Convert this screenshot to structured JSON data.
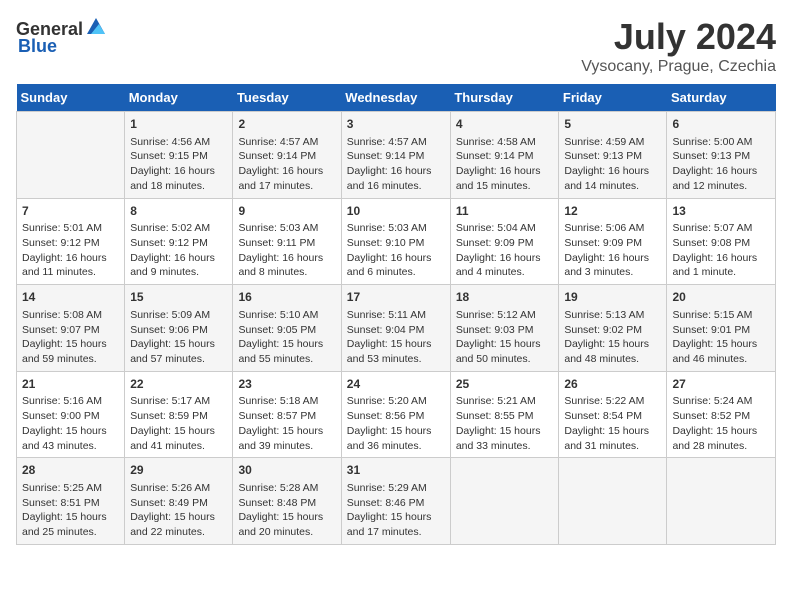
{
  "header": {
    "logo_general": "General",
    "logo_blue": "Blue",
    "month": "July 2024",
    "location": "Vysocany, Prague, Czechia"
  },
  "days": [
    "Sunday",
    "Monday",
    "Tuesday",
    "Wednesday",
    "Thursday",
    "Friday",
    "Saturday"
  ],
  "weeks": [
    [
      {
        "day": "",
        "info": ""
      },
      {
        "day": "1",
        "info": "Sunrise: 4:56 AM\nSunset: 9:15 PM\nDaylight: 16 hours\nand 18 minutes."
      },
      {
        "day": "2",
        "info": "Sunrise: 4:57 AM\nSunset: 9:14 PM\nDaylight: 16 hours\nand 17 minutes."
      },
      {
        "day": "3",
        "info": "Sunrise: 4:57 AM\nSunset: 9:14 PM\nDaylight: 16 hours\nand 16 minutes."
      },
      {
        "day": "4",
        "info": "Sunrise: 4:58 AM\nSunset: 9:14 PM\nDaylight: 16 hours\nand 15 minutes."
      },
      {
        "day": "5",
        "info": "Sunrise: 4:59 AM\nSunset: 9:13 PM\nDaylight: 16 hours\nand 14 minutes."
      },
      {
        "day": "6",
        "info": "Sunrise: 5:00 AM\nSunset: 9:13 PM\nDaylight: 16 hours\nand 12 minutes."
      }
    ],
    [
      {
        "day": "7",
        "info": "Sunrise: 5:01 AM\nSunset: 9:12 PM\nDaylight: 16 hours\nand 11 minutes."
      },
      {
        "day": "8",
        "info": "Sunrise: 5:02 AM\nSunset: 9:12 PM\nDaylight: 16 hours\nand 9 minutes."
      },
      {
        "day": "9",
        "info": "Sunrise: 5:03 AM\nSunset: 9:11 PM\nDaylight: 16 hours\nand 8 minutes."
      },
      {
        "day": "10",
        "info": "Sunrise: 5:03 AM\nSunset: 9:10 PM\nDaylight: 16 hours\nand 6 minutes."
      },
      {
        "day": "11",
        "info": "Sunrise: 5:04 AM\nSunset: 9:09 PM\nDaylight: 16 hours\nand 4 minutes."
      },
      {
        "day": "12",
        "info": "Sunrise: 5:06 AM\nSunset: 9:09 PM\nDaylight: 16 hours\nand 3 minutes."
      },
      {
        "day": "13",
        "info": "Sunrise: 5:07 AM\nSunset: 9:08 PM\nDaylight: 16 hours\nand 1 minute."
      }
    ],
    [
      {
        "day": "14",
        "info": "Sunrise: 5:08 AM\nSunset: 9:07 PM\nDaylight: 15 hours\nand 59 minutes."
      },
      {
        "day": "15",
        "info": "Sunrise: 5:09 AM\nSunset: 9:06 PM\nDaylight: 15 hours\nand 57 minutes."
      },
      {
        "day": "16",
        "info": "Sunrise: 5:10 AM\nSunset: 9:05 PM\nDaylight: 15 hours\nand 55 minutes."
      },
      {
        "day": "17",
        "info": "Sunrise: 5:11 AM\nSunset: 9:04 PM\nDaylight: 15 hours\nand 53 minutes."
      },
      {
        "day": "18",
        "info": "Sunrise: 5:12 AM\nSunset: 9:03 PM\nDaylight: 15 hours\nand 50 minutes."
      },
      {
        "day": "19",
        "info": "Sunrise: 5:13 AM\nSunset: 9:02 PM\nDaylight: 15 hours\nand 48 minutes."
      },
      {
        "day": "20",
        "info": "Sunrise: 5:15 AM\nSunset: 9:01 PM\nDaylight: 15 hours\nand 46 minutes."
      }
    ],
    [
      {
        "day": "21",
        "info": "Sunrise: 5:16 AM\nSunset: 9:00 PM\nDaylight: 15 hours\nand 43 minutes."
      },
      {
        "day": "22",
        "info": "Sunrise: 5:17 AM\nSunset: 8:59 PM\nDaylight: 15 hours\nand 41 minutes."
      },
      {
        "day": "23",
        "info": "Sunrise: 5:18 AM\nSunset: 8:57 PM\nDaylight: 15 hours\nand 39 minutes."
      },
      {
        "day": "24",
        "info": "Sunrise: 5:20 AM\nSunset: 8:56 PM\nDaylight: 15 hours\nand 36 minutes."
      },
      {
        "day": "25",
        "info": "Sunrise: 5:21 AM\nSunset: 8:55 PM\nDaylight: 15 hours\nand 33 minutes."
      },
      {
        "day": "26",
        "info": "Sunrise: 5:22 AM\nSunset: 8:54 PM\nDaylight: 15 hours\nand 31 minutes."
      },
      {
        "day": "27",
        "info": "Sunrise: 5:24 AM\nSunset: 8:52 PM\nDaylight: 15 hours\nand 28 minutes."
      }
    ],
    [
      {
        "day": "28",
        "info": "Sunrise: 5:25 AM\nSunset: 8:51 PM\nDaylight: 15 hours\nand 25 minutes."
      },
      {
        "day": "29",
        "info": "Sunrise: 5:26 AM\nSunset: 8:49 PM\nDaylight: 15 hours\nand 22 minutes."
      },
      {
        "day": "30",
        "info": "Sunrise: 5:28 AM\nSunset: 8:48 PM\nDaylight: 15 hours\nand 20 minutes."
      },
      {
        "day": "31",
        "info": "Sunrise: 5:29 AM\nSunset: 8:46 PM\nDaylight: 15 hours\nand 17 minutes."
      },
      {
        "day": "",
        "info": ""
      },
      {
        "day": "",
        "info": ""
      },
      {
        "day": "",
        "info": ""
      }
    ]
  ]
}
